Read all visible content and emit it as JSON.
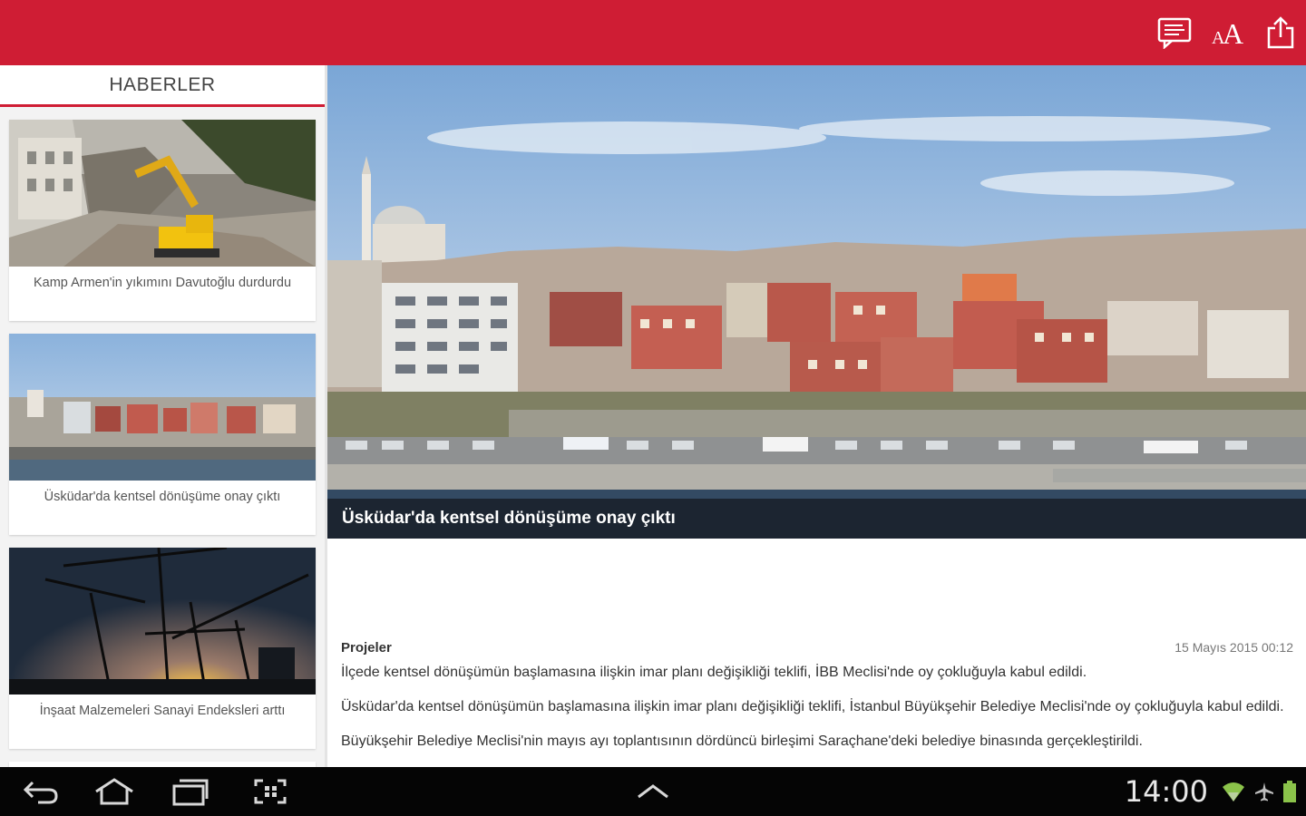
{
  "app": {
    "brand_color": "#cf1d34"
  },
  "toolbar": {
    "icons": [
      "comments-icon",
      "text-size-icon",
      "share-icon"
    ],
    "text_size_label": "AA"
  },
  "sidebar": {
    "title": "HABERLER",
    "items": [
      {
        "caption": "Kamp Armen'in yıkımını Davutoğlu durdurdu",
        "image": "demolition-excavator-image"
      },
      {
        "caption": "Üsküdar'da kentsel dönüşüme onay çıktı",
        "image": "uskudar-coast-image"
      },
      {
        "caption": "İnşaat Malzemeleri Sanayi Endeksleri arttı",
        "image": "construction-cranes-sunset-image"
      }
    ]
  },
  "article": {
    "hero_caption": "Üsküdar'da kentsel dönüşüme onay çıktı",
    "category": "Projeler",
    "date": "15 Mayıs 2015 00:12",
    "lead": "İlçede kentsel dönüşümün başlamasına ilişkin imar planı değişikliği teklifi, İBB Meclisi'nde oy çokluğuyla kabul edildi.",
    "body_1": "Üsküdar'da kentsel dönüşümün başlamasına ilişkin imar planı değişikliği teklifi, İstanbul Büyükşehir Belediye Meclisi'nde oy çokluğuyla kabul edildi.",
    "body_2": "Büyükşehir Belediye Meclisi'nin mayıs ayı toplantısının dördüncü birleşimi Saraçhane'deki belediye binasında gerçekleştirildi."
  },
  "system": {
    "time": "14:00",
    "nav_icons": [
      "back-icon",
      "home-icon",
      "recent-apps-icon",
      "screenshot-icon",
      "up-arrow-icon"
    ],
    "status_icons": [
      "wifi-icon",
      "airplane-icon",
      "battery-icon"
    ]
  }
}
